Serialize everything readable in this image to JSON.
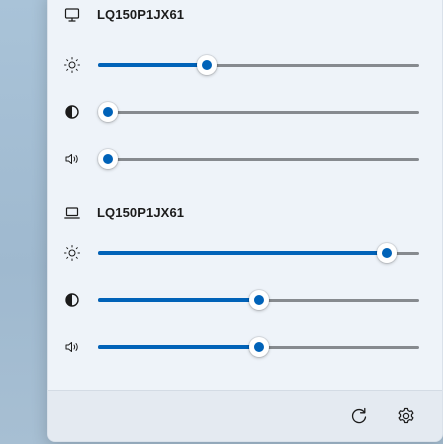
{
  "monitors": [
    {
      "name": "LQ150P1JX61",
      "icon": "desktop-monitor-icon",
      "sliders": [
        {
          "name": "brightness",
          "icon": "brightness-sun-icon",
          "value": 0.34
        },
        {
          "name": "contrast",
          "icon": "contrast-icon",
          "value": 0.03
        },
        {
          "name": "volume",
          "icon": "speaker-volume-icon",
          "value": 0.03
        }
      ]
    },
    {
      "name": "LQ150P1JX61",
      "icon": "laptop-icon",
      "sliders": [
        {
          "name": "brightness",
          "icon": "brightness-sun-icon",
          "value": 0.9
        },
        {
          "name": "contrast",
          "icon": "contrast-icon",
          "value": 0.5
        },
        {
          "name": "volume",
          "icon": "speaker-volume-icon",
          "value": 0.5
        }
      ]
    }
  ],
  "footer": {
    "buttons": [
      {
        "name": "refresh",
        "icon": "refresh-icon"
      },
      {
        "name": "settings",
        "icon": "gear-icon"
      }
    ]
  },
  "colors": {
    "accent": "#0062b8",
    "track": "#868a8f",
    "panel_background": "#eef3f9",
    "footer_background": "#e4eaf1",
    "desktop_background": "#a7bfd3"
  }
}
